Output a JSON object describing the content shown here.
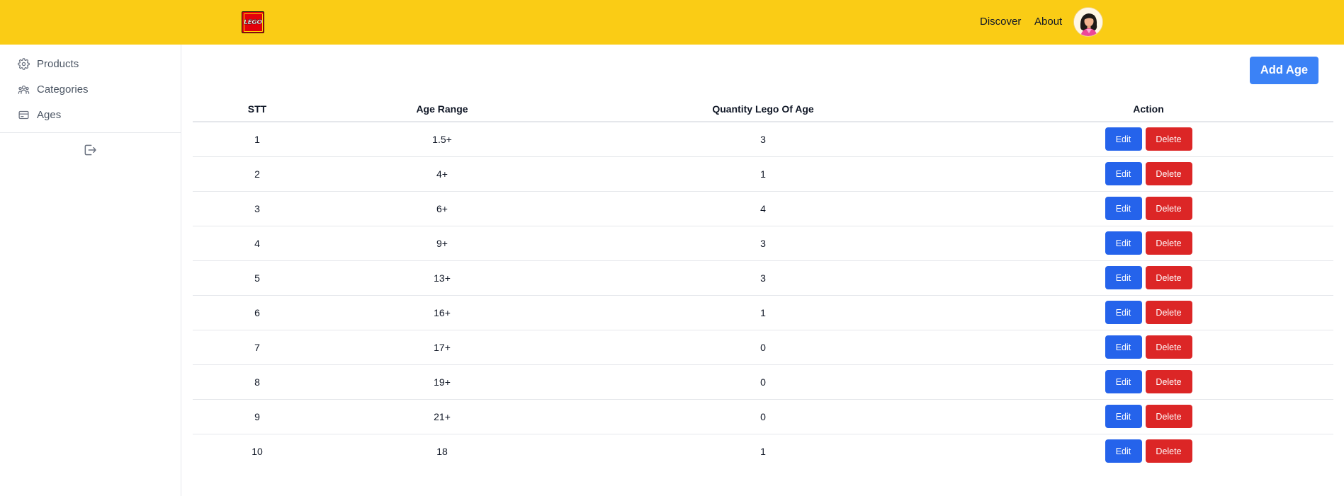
{
  "header": {
    "logo_text": "LEGO",
    "nav": {
      "discover": "Discover",
      "about": "About"
    },
    "avatar_icon": "user-avatar",
    "accent": "#facc15"
  },
  "sidebar": {
    "items": [
      {
        "label": "Products",
        "icon": "gear-icon"
      },
      {
        "label": "Categories",
        "icon": "users-group-icon"
      },
      {
        "label": "Ages",
        "icon": "card-icon"
      }
    ],
    "logout_icon": "logout-icon"
  },
  "main": {
    "add_button": "Add Age",
    "table": {
      "columns": [
        "STT",
        "Age Range",
        "Quantity Lego Of Age",
        "Action"
      ],
      "edit_label": "Edit",
      "delete_label": "Delete",
      "rows": [
        {
          "stt": "1",
          "range": "1.5+",
          "qty": "3"
        },
        {
          "stt": "2",
          "range": "4+",
          "qty": "1"
        },
        {
          "stt": "3",
          "range": "6+",
          "qty": "4"
        },
        {
          "stt": "4",
          "range": "9+",
          "qty": "3"
        },
        {
          "stt": "5",
          "range": "13+",
          "qty": "3"
        },
        {
          "stt": "6",
          "range": "16+",
          "qty": "1"
        },
        {
          "stt": "7",
          "range": "17+",
          "qty": "0"
        },
        {
          "stt": "8",
          "range": "19+",
          "qty": "0"
        },
        {
          "stt": "9",
          "range": "21+",
          "qty": "0"
        },
        {
          "stt": "10",
          "range": "18",
          "qty": "1"
        }
      ]
    },
    "colors": {
      "edit": "#2563eb",
      "delete": "#dc2626",
      "add": "#3b82f6"
    }
  }
}
